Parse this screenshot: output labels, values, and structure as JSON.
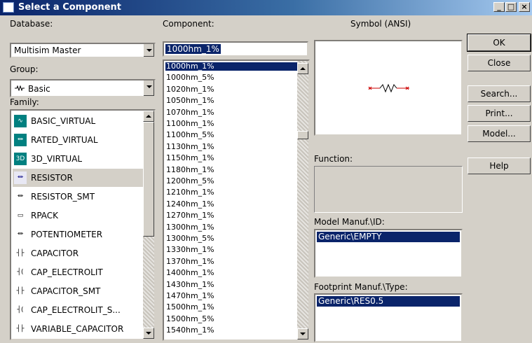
{
  "window": {
    "title": "Select a Component",
    "min_label": "_",
    "max_label": "□",
    "close_label": "×"
  },
  "database": {
    "label": "Database:",
    "value": "Multisim Master"
  },
  "group": {
    "label": "Group:",
    "value": "Basic",
    "icon": "resistor-icon"
  },
  "family": {
    "label": "Family:",
    "items": [
      {
        "label": "BASIC_VIRTUAL",
        "icon": "basic-virtual-icon",
        "color": "#008080"
      },
      {
        "label": "RATED_VIRTUAL",
        "icon": "rated-virtual-icon",
        "color": "#008080"
      },
      {
        "label": "3D_VIRTUAL",
        "icon": "3d-virtual-icon",
        "color": "#008080"
      },
      {
        "label": "RESISTOR",
        "icon": "resistor-icon",
        "color": "#000080"
      },
      {
        "label": "RESISTOR_SMT",
        "icon": "resistor-smt-icon",
        "color": "#000000"
      },
      {
        "label": "RPACK",
        "icon": "rpack-icon",
        "color": "#000000"
      },
      {
        "label": "POTENTIOMETER",
        "icon": "potentiometer-icon",
        "color": "#000000"
      },
      {
        "label": "CAPACITOR",
        "icon": "capacitor-icon",
        "color": "#000000"
      },
      {
        "label": "CAP_ELECTROLIT",
        "icon": "cap-electrolit-icon",
        "color": "#000000"
      },
      {
        "label": "CAPACITOR_SMT",
        "icon": "capacitor-smt-icon",
        "color": "#000000"
      },
      {
        "label": "CAP_ELECTROLIT_S...",
        "icon": "cap-electrolit-smt-icon",
        "color": "#000000"
      },
      {
        "label": "VARIABLE_CAPACITOR",
        "icon": "variable-capacitor-icon",
        "color": "#000000"
      }
    ],
    "selected_index": 3
  },
  "component": {
    "label": "Component:",
    "input_value": "1000hm_1%",
    "items": [
      "1000hm_1%",
      "1000hm_5%",
      "1020hm_1%",
      "1050hm_1%",
      "1070hm_1%",
      "1100hm_1%",
      "1100hm_5%",
      "1130hm_1%",
      "1150hm_1%",
      "1180hm_1%",
      "1200hm_5%",
      "1210hm_1%",
      "1240hm_1%",
      "1270hm_1%",
      "1300hm_1%",
      "1300hm_5%",
      "1330hm_1%",
      "1370hm_1%",
      "1400hm_1%",
      "1430hm_1%",
      "1470hm_1%",
      "1500hm_1%",
      "1500hm_5%",
      "1540hm_1%"
    ],
    "selected_index": 0
  },
  "symbol": {
    "label": "Symbol (ANSI)",
    "icon": "resistor-symbol-icon",
    "color": "#cc0000"
  },
  "function": {
    "label": "Function:"
  },
  "model": {
    "label": "Model Manuf.\\ID:",
    "selected": "Generic\\EMPTY"
  },
  "footprint": {
    "label": "Footprint Manuf.\\Type:",
    "selected": "Generic\\RES0.5"
  },
  "buttons": {
    "ok": "OK",
    "close": "Close",
    "search": "Search...",
    "print": "Print...",
    "model": "Model...",
    "help": "Help"
  }
}
